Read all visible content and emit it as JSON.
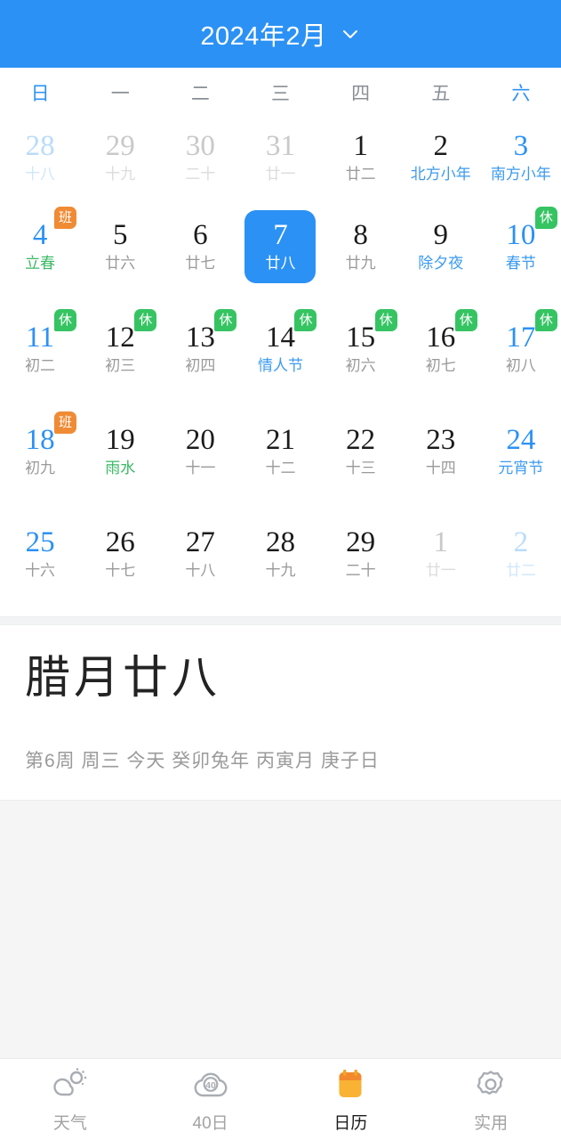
{
  "header": {
    "title": "2024年2月",
    "dropdown_icon": "chevron-down-icon",
    "bg_color": "#2b91f5"
  },
  "weekbar": [
    {
      "label": "日",
      "accent": true
    },
    {
      "label": "一",
      "accent": false
    },
    {
      "label": "二",
      "accent": false
    },
    {
      "label": "三",
      "accent": false
    },
    {
      "label": "四",
      "accent": false
    },
    {
      "label": "五",
      "accent": false
    },
    {
      "label": "六",
      "accent": true
    }
  ],
  "colors": {
    "accent": "#2b91f5",
    "rest_badge": "#36c463",
    "work_badge": "#f08b35",
    "solar_term": "#3ab964",
    "festival": "#3c9bf0",
    "muted": "#9a9a9a"
  },
  "calendar": {
    "weeks": [
      [
        {
          "num": "28",
          "sub": "十八",
          "num_style": "ltblue",
          "sub_style": "ltblue",
          "badge": null,
          "selected": false
        },
        {
          "num": "29",
          "sub": "十九",
          "num_style": "gray",
          "sub_style": "ltgray",
          "badge": null,
          "selected": false
        },
        {
          "num": "30",
          "sub": "二十",
          "num_style": "gray",
          "sub_style": "ltgray",
          "badge": null,
          "selected": false
        },
        {
          "num": "31",
          "sub": "廿一",
          "num_style": "gray",
          "sub_style": "ltgray",
          "badge": null,
          "selected": false
        },
        {
          "num": "1",
          "sub": "廿二",
          "num_style": "",
          "sub_style": "gray",
          "badge": null,
          "selected": false
        },
        {
          "num": "2",
          "sub": "北方小年",
          "num_style": "",
          "sub_style": "blue",
          "badge": null,
          "selected": false
        },
        {
          "num": "3",
          "sub": "南方小年",
          "num_style": "blue",
          "sub_style": "blue",
          "badge": null,
          "selected": false
        }
      ],
      [
        {
          "num": "4",
          "sub": "立春",
          "num_style": "blue",
          "sub_style": "green",
          "badge": "班",
          "badge_type": "work",
          "selected": false
        },
        {
          "num": "5",
          "sub": "廿六",
          "num_style": "",
          "sub_style": "gray",
          "badge": null,
          "selected": false
        },
        {
          "num": "6",
          "sub": "廿七",
          "num_style": "",
          "sub_style": "gray",
          "badge": null,
          "selected": false
        },
        {
          "num": "7",
          "sub": "廿八",
          "num_style": "white",
          "sub_style": "white",
          "badge": null,
          "selected": true
        },
        {
          "num": "8",
          "sub": "廿九",
          "num_style": "",
          "sub_style": "gray",
          "badge": null,
          "selected": false
        },
        {
          "num": "9",
          "sub": "除夕夜",
          "num_style": "",
          "sub_style": "blue",
          "badge": null,
          "selected": false
        },
        {
          "num": "10",
          "sub": "春节",
          "num_style": "blue",
          "sub_style": "blue",
          "badge": "休",
          "badge_type": "rest",
          "selected": false
        }
      ],
      [
        {
          "num": "11",
          "sub": "初二",
          "num_style": "blue",
          "sub_style": "gray",
          "badge": "休",
          "badge_type": "rest",
          "selected": false
        },
        {
          "num": "12",
          "sub": "初三",
          "num_style": "",
          "sub_style": "gray",
          "badge": "休",
          "badge_type": "rest",
          "selected": false
        },
        {
          "num": "13",
          "sub": "初四",
          "num_style": "",
          "sub_style": "gray",
          "badge": "休",
          "badge_type": "rest",
          "selected": false
        },
        {
          "num": "14",
          "sub": "情人节",
          "num_style": "",
          "sub_style": "blue",
          "badge": "休",
          "badge_type": "rest",
          "selected": false
        },
        {
          "num": "15",
          "sub": "初六",
          "num_style": "",
          "sub_style": "gray",
          "badge": "休",
          "badge_type": "rest",
          "selected": false
        },
        {
          "num": "16",
          "sub": "初七",
          "num_style": "",
          "sub_style": "gray",
          "badge": "休",
          "badge_type": "rest",
          "selected": false
        },
        {
          "num": "17",
          "sub": "初八",
          "num_style": "blue",
          "sub_style": "gray",
          "badge": "休",
          "badge_type": "rest",
          "selected": false
        }
      ],
      [
        {
          "num": "18",
          "sub": "初九",
          "num_style": "blue",
          "sub_style": "gray",
          "badge": "班",
          "badge_type": "work",
          "selected": false
        },
        {
          "num": "19",
          "sub": "雨水",
          "num_style": "",
          "sub_style": "green",
          "badge": null,
          "selected": false
        },
        {
          "num": "20",
          "sub": "十一",
          "num_style": "",
          "sub_style": "gray",
          "badge": null,
          "selected": false
        },
        {
          "num": "21",
          "sub": "十二",
          "num_style": "",
          "sub_style": "gray",
          "badge": null,
          "selected": false
        },
        {
          "num": "22",
          "sub": "十三",
          "num_style": "",
          "sub_style": "gray",
          "badge": null,
          "selected": false
        },
        {
          "num": "23",
          "sub": "十四",
          "num_style": "",
          "sub_style": "gray",
          "badge": null,
          "selected": false
        },
        {
          "num": "24",
          "sub": "元宵节",
          "num_style": "blue",
          "sub_style": "blue",
          "badge": null,
          "selected": false
        }
      ],
      [
        {
          "num": "25",
          "sub": "十六",
          "num_style": "blue",
          "sub_style": "gray",
          "badge": null,
          "selected": false
        },
        {
          "num": "26",
          "sub": "十七",
          "num_style": "",
          "sub_style": "gray",
          "badge": null,
          "selected": false
        },
        {
          "num": "27",
          "sub": "十八",
          "num_style": "",
          "sub_style": "gray",
          "badge": null,
          "selected": false
        },
        {
          "num": "28",
          "sub": "十九",
          "num_style": "",
          "sub_style": "gray",
          "badge": null,
          "selected": false
        },
        {
          "num": "29",
          "sub": "二十",
          "num_style": "",
          "sub_style": "gray",
          "badge": null,
          "selected": false
        },
        {
          "num": "1",
          "sub": "廿一",
          "num_style": "gray",
          "sub_style": "ltgray",
          "badge": null,
          "selected": false
        },
        {
          "num": "2",
          "sub": "廿二",
          "num_style": "ltblue",
          "sub_style": "ltblue",
          "badge": null,
          "selected": false
        }
      ]
    ]
  },
  "detail": {
    "lunar_date": "腊月廿八",
    "meta": "第6周 周三 今天 癸卯兔年 丙寅月 庚子日"
  },
  "tabbar": [
    {
      "label": "天气",
      "icon": "cloud-sun-icon",
      "active": false
    },
    {
      "label": "40日",
      "icon": "cloud-40-icon",
      "active": false
    },
    {
      "label": "日历",
      "icon": "calendar-icon",
      "active": true
    },
    {
      "label": "实用",
      "icon": "gear-icon",
      "active": false
    }
  ]
}
